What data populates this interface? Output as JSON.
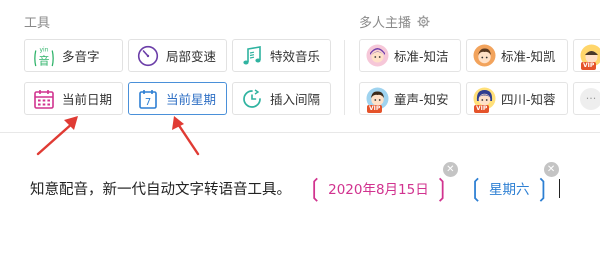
{
  "tools": {
    "title": "工具",
    "buttons": [
      {
        "label": "多音字",
        "icon": "duoyin-icon",
        "badge": "yin",
        "glyph": "音"
      },
      {
        "label": "局部变速",
        "icon": "speed-dial-icon"
      },
      {
        "label": "特效音乐",
        "icon": "music-notes-icon"
      },
      {
        "label": "当前日期",
        "icon": "calendar-icon"
      },
      {
        "label": "当前星期",
        "icon": "week-calendar-icon",
        "glyph": "7"
      },
      {
        "label": "插入间隔",
        "icon": "interval-clock-icon"
      }
    ]
  },
  "voices": {
    "title": "多人主播",
    "items": [
      {
        "label": "标准-知洁",
        "avatar": "girl-avatar-pink"
      },
      {
        "label": "标准-知凯",
        "avatar": "boy-avatar-orange"
      },
      {
        "label": "童声-知安",
        "avatar": "child-avatar-blue",
        "vip": "VIP"
      },
      {
        "label": "四川-知蓉",
        "avatar": "girl-avatar-yellow",
        "vip": "VIP"
      }
    ],
    "more": "···",
    "badge": "VIP"
  },
  "editor": {
    "text": "知意配音，新一代自动文字转语音工具。",
    "date_tag": "2020年8月15日",
    "week_tag": "星期六"
  },
  "colors": {
    "accent_blue": "#2d7fd3",
    "date_pink": "#d1338f",
    "arrow_red": "#e03b34",
    "tool_green": "#2fb36a"
  }
}
